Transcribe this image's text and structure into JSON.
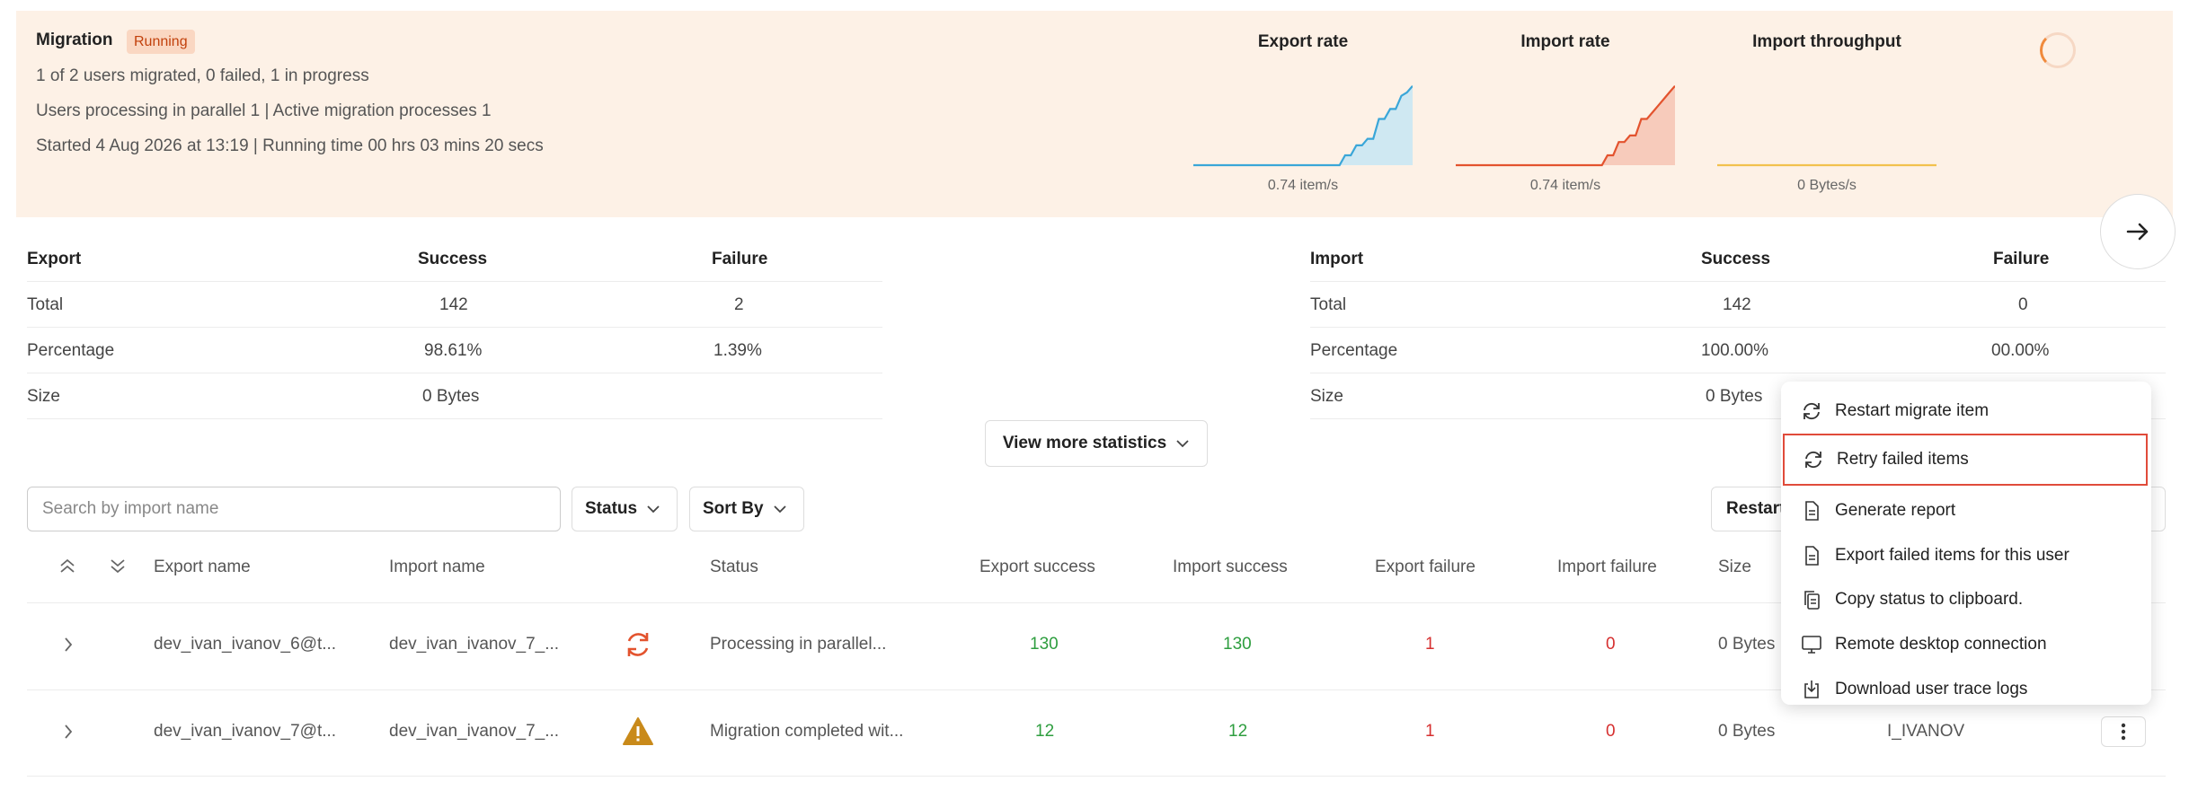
{
  "migration": {
    "title": "Migration",
    "status_badge": "Running",
    "line1": "1 of 2 users migrated, 0 failed, 1 in progress",
    "line2": "Users processing in parallel 1 | Active migration processes 1",
    "line3": "Started 4 Aug 2026 at 13:19 | Running time 00 hrs 03 mins 20 secs"
  },
  "chart_data": [
    {
      "type": "area",
      "title": "Export rate",
      "caption": "0.74 item/s",
      "color": "#3aa6d8",
      "fill": "#cfe8f2",
      "values": [
        0,
        0,
        0,
        0,
        0,
        0,
        0,
        0,
        0,
        0,
        0,
        0,
        0,
        0,
        0,
        0,
        0,
        0,
        0,
        0,
        0,
        0,
        0,
        0,
        0,
        0,
        0,
        0.6,
        0.6,
        1.2,
        1.2,
        1.6,
        1.6,
        2.8,
        2.8,
        3.4,
        3.4,
        4.2,
        4.4,
        4.8
      ]
    },
    {
      "type": "area",
      "title": "Import rate",
      "caption": "0.74 item/s",
      "color": "#e3532e",
      "fill": "#f7cbbb",
      "values": [
        0,
        0,
        0,
        0,
        0,
        0,
        0,
        0,
        0,
        0,
        0,
        0,
        0,
        0,
        0,
        0,
        0,
        0,
        0,
        0,
        0,
        0,
        0,
        0,
        0,
        0,
        0,
        0.6,
        0.6,
        1.4,
        1.4,
        1.8,
        1.8,
        2.8,
        2.8,
        3.2,
        3.6,
        4.0,
        4.4,
        4.8
      ]
    },
    {
      "type": "line",
      "title": "Import throughput",
      "caption": "0 Bytes/s",
      "color": "#f2c14e",
      "values": [
        0,
        0,
        0,
        0,
        0,
        0,
        0,
        0,
        0,
        0,
        0,
        0,
        0,
        0,
        0,
        0,
        0,
        0,
        0,
        0,
        0,
        0,
        0,
        0,
        0,
        0,
        0,
        0,
        0,
        0,
        0,
        0,
        0,
        0,
        0,
        0,
        0,
        0,
        0,
        0
      ]
    }
  ],
  "export_stats": {
    "headers": [
      "Export",
      "Success",
      "Failure"
    ],
    "rows": [
      [
        "Total",
        "142",
        "2"
      ],
      [
        "Percentage",
        "98.61%",
        "1.39%"
      ],
      [
        "Size",
        "0 Bytes",
        ""
      ]
    ]
  },
  "import_stats": {
    "headers": [
      "Import",
      "Success",
      "Failure"
    ],
    "rows": [
      [
        "Total",
        "142",
        "0"
      ],
      [
        "Percentage",
        "100.00%",
        "00.00%"
      ],
      [
        "Size",
        "0 Bytes",
        ""
      ]
    ]
  },
  "controls": {
    "view_more": "View more statistics",
    "search_placeholder": "Search by import name",
    "status_dd": "Status",
    "sort_dd": "Sort By",
    "restart_btn": "Restart"
  },
  "table": {
    "headers": [
      "Export name",
      "Import name",
      "Status",
      "Export success",
      "Import success",
      "Export failure",
      "Import failure",
      "Size"
    ],
    "rows": [
      {
        "export_name": "dev_ivan_ivanov_6@t...",
        "import_name": "dev_ivan_ivanov_7_...",
        "status_icon": "sync-icon",
        "status": "Processing in parallel...",
        "export_success": "130",
        "import_success": "130",
        "export_failure": "1",
        "import_failure": "0",
        "size": "0 Bytes",
        "user": ""
      },
      {
        "export_name": "dev_ivan_ivanov_7@t...",
        "import_name": "dev_ivan_ivanov_7_...",
        "status_icon": "warning-icon",
        "status": "Migration completed wit...",
        "export_success": "12",
        "import_success": "12",
        "export_failure": "1",
        "import_failure": "0",
        "size": "0 Bytes",
        "user": "I_IVANOV"
      }
    ]
  },
  "context_menu": {
    "items": [
      {
        "label": "Restart migrate item",
        "icon": "refresh-icon"
      },
      {
        "label": "Retry failed items",
        "icon": "refresh-icon",
        "selected": true
      },
      {
        "label": "Generate report",
        "icon": "document-icon"
      },
      {
        "label": "Export failed items for this user",
        "icon": "document-icon"
      },
      {
        "label": "Copy status to clipboard.",
        "icon": "copy-icon"
      },
      {
        "label": "Remote desktop connection",
        "icon": "monitor-icon"
      },
      {
        "label": "Download user trace logs",
        "icon": "download-icon"
      }
    ]
  }
}
